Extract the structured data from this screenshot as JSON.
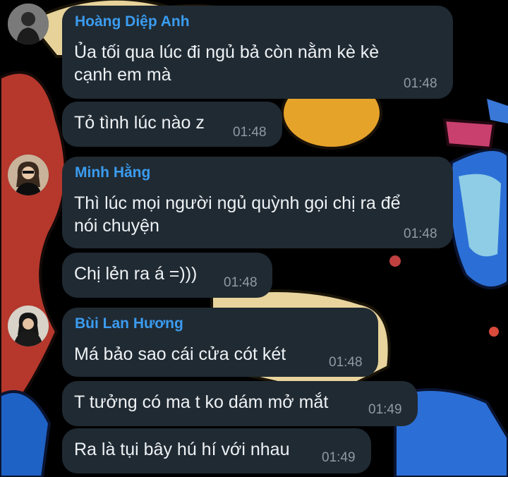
{
  "chat": {
    "colors": {
      "bubble": "#202a33",
      "sender": "#3b9cf0",
      "text": "#eef2f4",
      "time": "#8e9aa4"
    },
    "groups": [
      {
        "sender": "Hoàng Diệp Anh",
        "avatar": "user-avatar",
        "messages": [
          {
            "text": " Ủa tối qua lúc đi ngủ bả còn nằm kè kè\ncạnh em mà",
            "time": "01:48"
          },
          {
            "text": "Tỏ tình lúc nào z",
            "time": "01:48"
          }
        ]
      },
      {
        "sender": "Minh Hằng",
        "avatar": "user-avatar",
        "messages": [
          {
            "text": "Thì lúc mọi người ngủ quỳnh gọi chị ra để\nnói chuyện",
            "time": "01:48"
          },
          {
            "text": "Chị lẻn ra á =)))",
            "time": "01:48"
          }
        ]
      },
      {
        "sender": "Bùi Lan Hương",
        "avatar": "user-avatar",
        "messages": [
          {
            "text": "Má bảo sao cái cửa cót két",
            "time": "01:48"
          },
          {
            "text": "T tưởng có ma t ko dám mở mắt",
            "time": "01:49"
          },
          {
            "text": "Ra là tụi bây hú hí với nhau",
            "time": "01:49"
          }
        ]
      }
    ]
  }
}
